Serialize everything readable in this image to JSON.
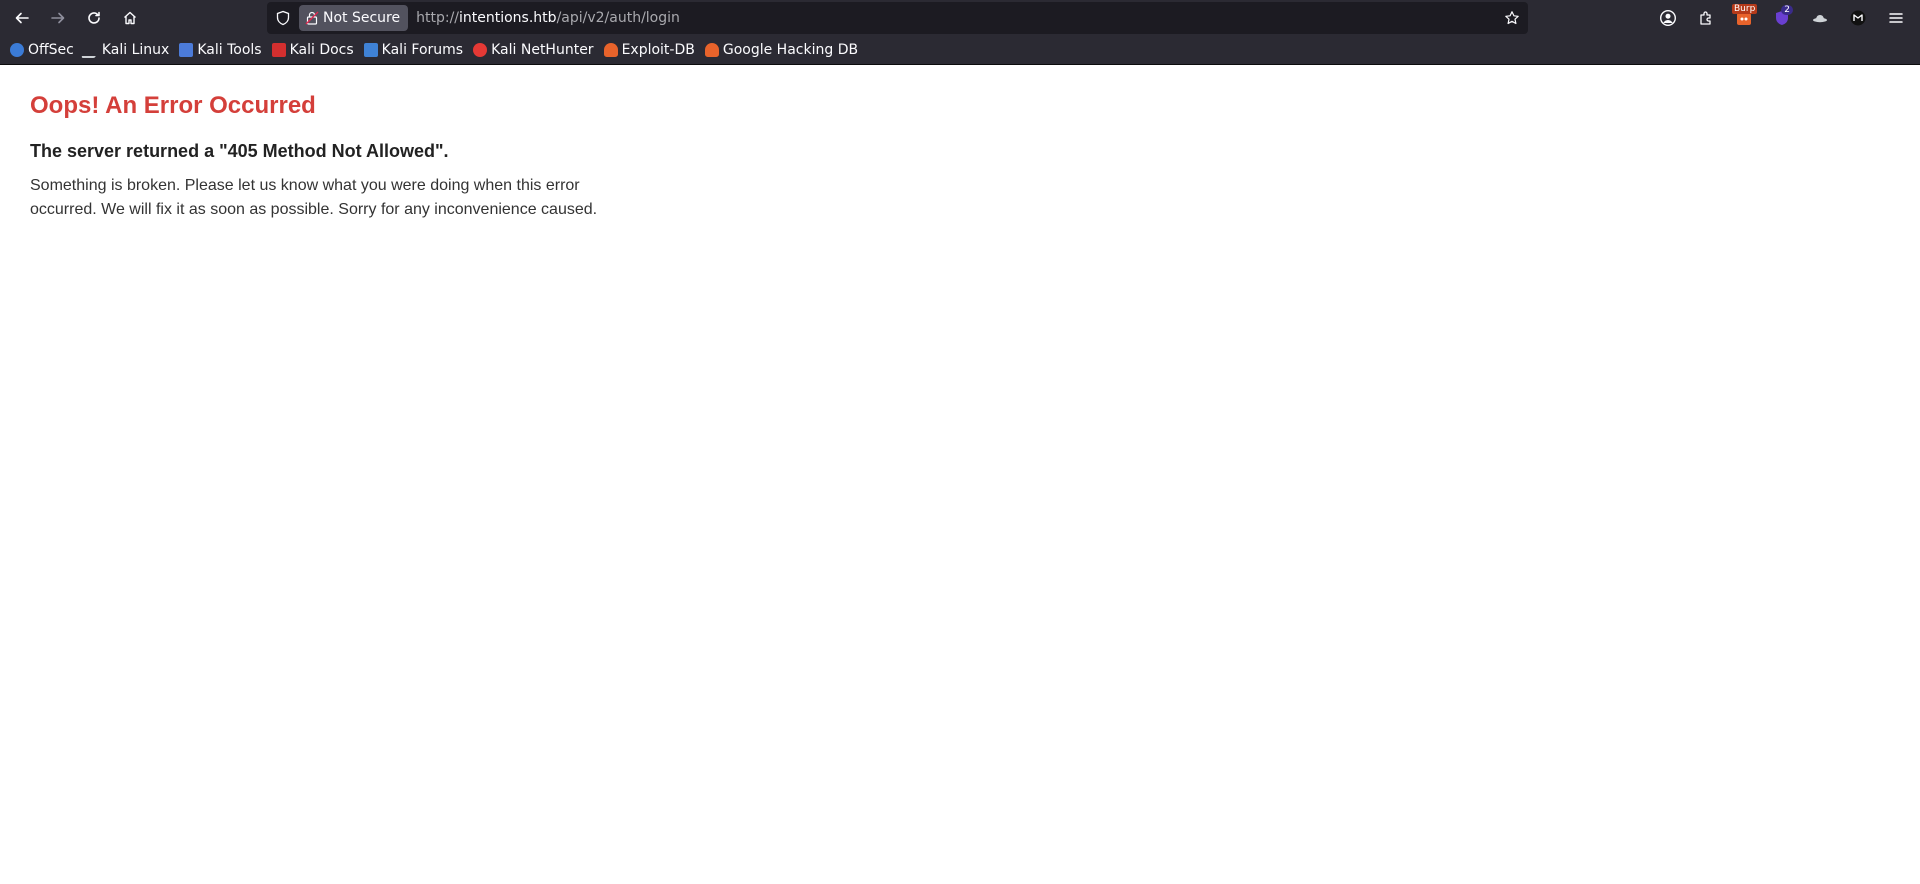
{
  "browser": {
    "security_label": "Not Secure",
    "url_scheme": "http://",
    "url_host": "intentions.htb",
    "url_path": "/api/v2/auth/login",
    "nav_icons": [
      "back-icon",
      "forward-icon",
      "reload-icon",
      "home-icon"
    ],
    "extension_icons": [
      "account-icon",
      "extensions-icon",
      "burp-icon",
      "ublock-icon",
      "hat-icon",
      "metamask-icon",
      "menu-icon"
    ],
    "burp_badge": "Burp",
    "ublock_badge": "2"
  },
  "bookmarks": [
    {
      "label": "OffSec",
      "icon": "offsec-icon",
      "color": "#3b7bd6"
    },
    {
      "label": "Kali Linux",
      "icon": "kali-linux-icon",
      "color": "#cfd3d7"
    },
    {
      "label": "Kali Tools",
      "icon": "kali-tools-icon",
      "color": "#4c7bd9"
    },
    {
      "label": "Kali Docs",
      "icon": "kali-docs-icon",
      "color": "#d32f2f"
    },
    {
      "label": "Kali Forums",
      "icon": "kali-forums-icon",
      "color": "#3f82d6"
    },
    {
      "label": "Kali NetHunter",
      "icon": "kali-nethunter-icon",
      "color": "#e53935"
    },
    {
      "label": "Exploit-DB",
      "icon": "exploit-db-icon",
      "color": "#e8632b"
    },
    {
      "label": "Google Hacking DB",
      "icon": "ghdb-icon",
      "color": "#e8632b"
    }
  ],
  "error": {
    "title": "Oops! An Error Occurred",
    "subtitle": "The server returned a \"405 Method Not Allowed\".",
    "body": "Something is broken. Please let us know what you were doing when this error occurred. We will fix it as soon as possible. Sorry for any inconvenience caused."
  },
  "colors": {
    "chrome_bg": "#2b2a33",
    "urlbar_bg": "#1c1b22",
    "title_red": "#d43f3a"
  }
}
